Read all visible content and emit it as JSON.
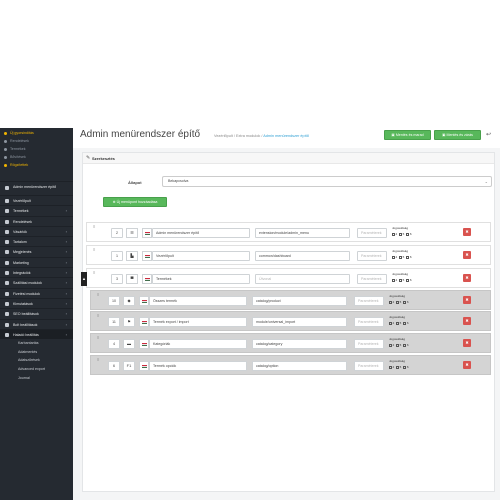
{
  "sidebar": {
    "top_items": [
      {
        "label": "Új gyorsindítás",
        "highlight": true
      },
      {
        "label": "Rendelések",
        "highlight": false
      },
      {
        "label": "Termékek",
        "highlight": false
      },
      {
        "label": "Bővítések",
        "highlight": false
      },
      {
        "label": "Rögzítettek",
        "highlight": true
      }
    ],
    "menu_items": [
      {
        "label": "Admin menürendszer építő",
        "label2": "építő",
        "chevron": false,
        "active": false
      },
      {
        "label": "Vezérlőpult",
        "chevron": false,
        "active": false
      },
      {
        "label": "Termékek",
        "chevron": true,
        "active": false
      },
      {
        "label": "Rendelések",
        "chevron": false,
        "active": false
      },
      {
        "label": "Vásárlók",
        "chevron": true,
        "active": false
      },
      {
        "label": "Tartalom",
        "chevron": true,
        "active": false
      },
      {
        "label": "Megjelenés",
        "chevron": true,
        "active": false
      },
      {
        "label": "Marketing",
        "chevron": true,
        "active": false
      },
      {
        "label": "Integrációk",
        "chevron": true,
        "active": false
      },
      {
        "label": "Szállítási modulok",
        "chevron": true,
        "active": false
      },
      {
        "label": "Fizetési modulok",
        "chevron": true,
        "active": false
      },
      {
        "label": "Kimutatások",
        "chevron": true,
        "active": false
      },
      {
        "label": "SEO beállítások",
        "chevron": true,
        "active": false
      },
      {
        "label": "Bolt beállítások",
        "chevron": true,
        "active": false
      },
      {
        "label": "Haladó beállítás",
        "chevron": true,
        "active": true
      }
    ],
    "sub_items": [
      "Karbantartás",
      "Adatmentés",
      "Adatszűrések",
      "Advanced export",
      "Journal"
    ]
  },
  "header": {
    "title": "Admin menürendszer építő",
    "breadcrumb": {
      "home": "Vezérlőpult",
      "sep": "/",
      "mid": "Extra modulok",
      "current": "Admin menürendszer építő"
    },
    "save_manual": "Mentés és marad",
    "save_close": "Mentés és zárás",
    "back_icon": "reply-icon"
  },
  "panel": {
    "title": "Szerkesztés",
    "status_label": "Állapot",
    "status_value": "Bekapcsolva",
    "add_button": "Új menüpont hozzáadása"
  },
  "rows": [
    {
      "sort": "2",
      "icon": "list-icon",
      "icon_glyph": "☰",
      "name": "Admin menürendszer építő",
      "route": "extension/module/admin_menu",
      "placeholder": "Paraméterek",
      "perm_title": "Jogosultság",
      "perms": [
        "4",
        "5",
        "6"
      ],
      "collapse": false
    },
    {
      "sort": "1",
      "icon": "chart-icon",
      "icon_glyph": "▙",
      "name": "Vezérlőpult",
      "route": "common/dashboard",
      "placeholder": "Paraméterek",
      "perm_title": "Jogosultság",
      "perms": [
        "4",
        "5",
        "6"
      ],
      "collapse": false
    },
    {
      "sort": "3",
      "icon": "cart-icon",
      "icon_glyph": "▀",
      "name": "Termékek",
      "route": "Útvonal",
      "placeholder": "Paraméterek",
      "perm_title": "Jogosultság",
      "perms": [
        "4",
        "5",
        "6"
      ],
      "collapse": true
    },
    {
      "sort": "10",
      "icon": "tag-icon",
      "icon_glyph": "◆",
      "name": "Összes termék",
      "route": "catalog/product",
      "placeholder": "Paraméterek",
      "perm_title": "Jogosultság",
      "perms": [
        "4",
        "5",
        "6"
      ],
      "collapse": false
    },
    {
      "sort": "11",
      "icon": "flag-icon",
      "icon_glyph": "⚑",
      "name": "Termék export / import",
      "route": "module/universal_import",
      "placeholder": "Paraméterek",
      "perm_title": "Jogosultság",
      "perms": [
        "4",
        "5",
        "6"
      ],
      "collapse": false
    },
    {
      "sort": "4",
      "icon": "folder-icon",
      "icon_glyph": "▬",
      "name": "Kategóriák",
      "route": "catalog/category",
      "placeholder": "Paraméterek",
      "perm_title": "Jogosultság",
      "perms": [
        "4",
        "5",
        "6"
      ],
      "collapse": false
    },
    {
      "sort": "6",
      "icon": "keyboard-icon",
      "icon_glyph": "F1",
      "name": "Termék opciók",
      "route": "catalog/option",
      "placeholder": "Paraméterek",
      "perm_title": "Jogosultság",
      "perms": [
        "4",
        "5",
        "6"
      ],
      "collapse": false
    }
  ],
  "colors": {
    "sidebar_bg": "#252a31",
    "accent_green": "#58b85b",
    "accent_yellow": "#f0b400",
    "delete_red": "#d9534f",
    "link_blue": "#2e9fd3"
  }
}
